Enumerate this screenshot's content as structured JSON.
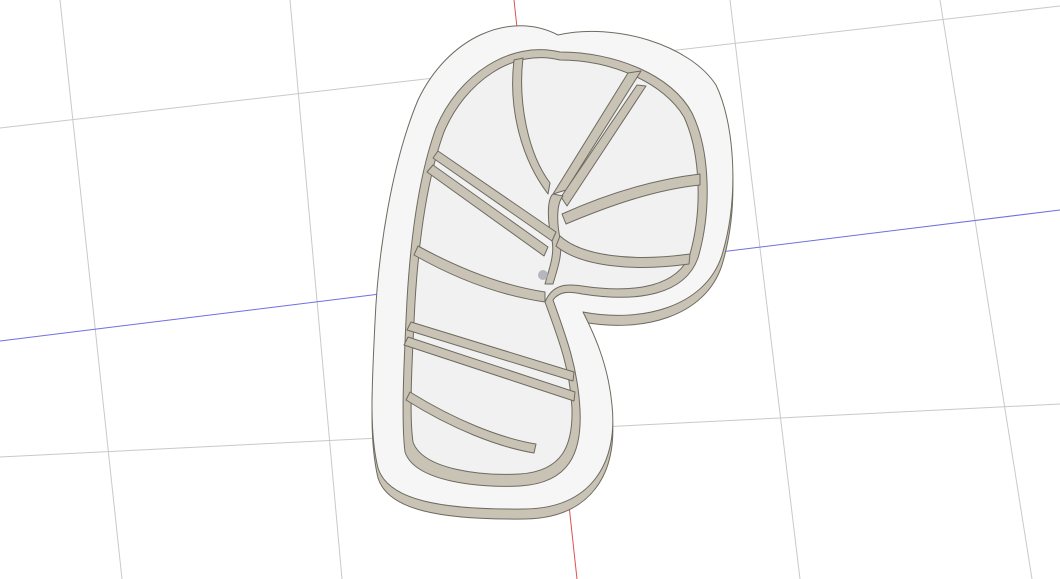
{
  "viewport": {
    "background": "#ffffff",
    "grid_color": "#c9c9c9",
    "axis_x_color": "#6f6fe0",
    "axis_y_color": "#e05050",
    "origin_marker_color": "#a8a8b0"
  },
  "model": {
    "shape": "candy-cane cookie cutter",
    "wall_top_color": "#f6f6f6",
    "wall_side_color": "#c9c3b5",
    "edge_color": "#6d6a60",
    "interior_color": "#f1f1f1"
  }
}
